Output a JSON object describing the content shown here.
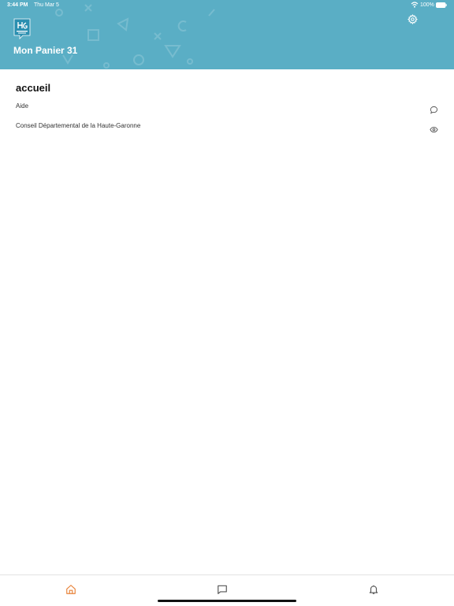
{
  "status_bar": {
    "time": "3:44 PM",
    "date": "Thu Mar 5",
    "battery": "100%",
    "wifi_icon": "wifi-icon",
    "battery_icon": "battery-icon"
  },
  "header": {
    "logo_icon": "app-logo",
    "title": "Mon Panier 31",
    "settings_icon": "gear-icon",
    "background_color": "#5aaec5"
  },
  "main": {
    "section_title": "accueil",
    "items": [
      {
        "label": "Aide",
        "icon": "chat-bubble-icon"
      },
      {
        "label": "Conseil Départemental de la Haute-Garonne",
        "icon": "eye-icon"
      }
    ]
  },
  "tabbar": {
    "tabs": [
      {
        "icon": "home-icon",
        "active": true,
        "color": "#e8833a"
      },
      {
        "icon": "message-icon",
        "active": false,
        "color": "#555555"
      },
      {
        "icon": "bell-icon",
        "active": false,
        "color": "#555555"
      }
    ]
  }
}
